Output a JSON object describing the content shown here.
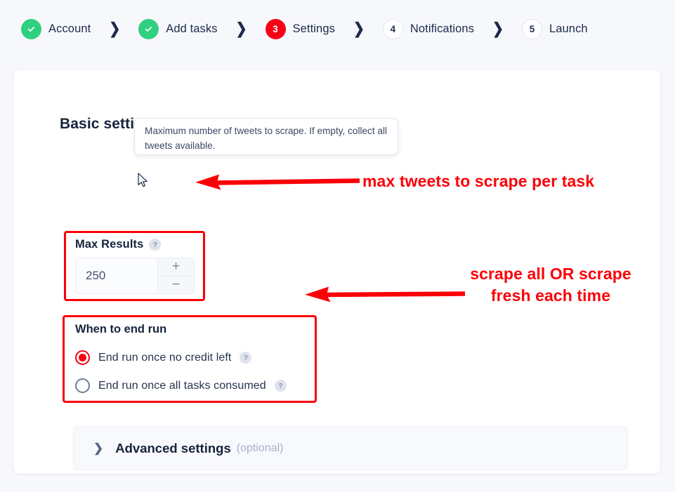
{
  "stepper": {
    "steps": [
      {
        "badge": "check",
        "label": "Account",
        "state": "done"
      },
      {
        "badge": "check",
        "label": "Add tasks",
        "state": "done"
      },
      {
        "badge": "3",
        "label": "Settings",
        "state": "current"
      },
      {
        "badge": "4",
        "label": "Notifications",
        "state": "todo"
      },
      {
        "badge": "5",
        "label": "Launch",
        "state": "todo"
      }
    ],
    "separator": "❯"
  },
  "card": {
    "section_title": "Basic settings",
    "tooltip": "Maximum number of tweets to scrape. If empty, collect all tweets available.",
    "max_results": {
      "label": "Max Results",
      "help": "?",
      "value": "250",
      "increment": "+",
      "decrement": "−"
    },
    "end_run": {
      "title": "When to end run",
      "options": [
        {
          "label": "End run once no credit left",
          "selected": true,
          "help": "?"
        },
        {
          "label": "End run once all tasks consumed",
          "selected": false,
          "help": "?"
        }
      ]
    },
    "advanced": {
      "chevron": "❯",
      "title": "Advanced settings",
      "optional": "(optional)"
    }
  },
  "annotations": [
    {
      "text": "max tweets to scrape per task"
    },
    {
      "line1": "scrape all OR scrape",
      "line2": "fresh each time"
    }
  ],
  "colors": {
    "accent_red": "#f50014",
    "annotation_red": "#fb0007",
    "done_green": "#2fd07f",
    "text_navy": "#17233d",
    "page_bg": "#f7f8fc"
  }
}
